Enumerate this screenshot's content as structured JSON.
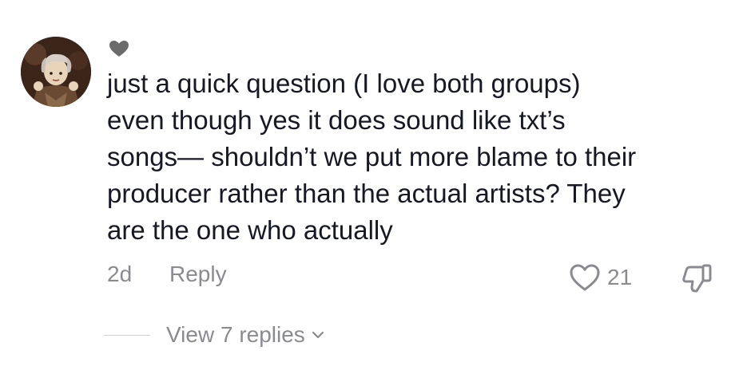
{
  "comment": {
    "text": "just a quick question (I love both groups)\neven though yes it does sound like txt’s\nsongs— shouldn’t we put more blame to their\nproducer rather than the actual artists? They\nare the one who actually",
    "time": "2d",
    "reply_label": "Reply",
    "like_count": "21",
    "view_replies_label": "View 7 replies"
  },
  "icons": {
    "creator_liked": "heart-filled-icon",
    "like": "heart-outline-icon",
    "dislike": "thumbs-down-icon",
    "expand": "chevron-down-icon"
  },
  "colors": {
    "text": "#161823",
    "secondary": "#8a8b91",
    "creator_heart": "#6b6b6b",
    "divider": "#cfd0d3"
  }
}
